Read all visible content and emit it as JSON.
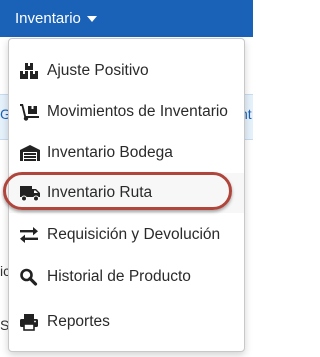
{
  "navbar": {
    "title": "Inventario"
  },
  "background": {
    "left_fragment": "G",
    "right_fragment": "nt",
    "left_fragment_2": "ic",
    "left_fragment_3": "S"
  },
  "menu": {
    "items": [
      {
        "label": "Ajuste Positivo",
        "icon": "boxes-icon"
      },
      {
        "label": "Movimientos de Inventario",
        "icon": "dolly-icon"
      },
      {
        "label": "Inventario Bodega",
        "icon": "warehouse-icon"
      },
      {
        "label": "Inventario Ruta",
        "icon": "truck-icon"
      },
      {
        "label": "Requisición y Devolución",
        "icon": "exchange-icon"
      },
      {
        "label": "Historial de Producto",
        "icon": "search-icon"
      },
      {
        "label": "Reportes",
        "icon": "print-icon"
      }
    ]
  },
  "colors": {
    "navbar": "#1a62b8",
    "highlight_ring": "#b0453c"
  }
}
